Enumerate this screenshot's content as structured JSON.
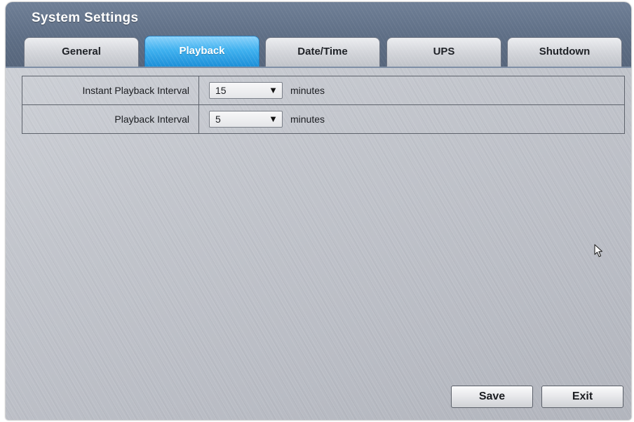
{
  "window": {
    "title": "System Settings"
  },
  "tabs": [
    {
      "label": "General",
      "active": false
    },
    {
      "label": "Playback",
      "active": true
    },
    {
      "label": "Date/Time",
      "active": false
    },
    {
      "label": "UPS",
      "active": false
    },
    {
      "label": "Shutdown",
      "active": false
    }
  ],
  "settings": [
    {
      "label": "Instant Playback Interval",
      "value": "15",
      "unit": "minutes"
    },
    {
      "label": "Playback Interval",
      "value": "5",
      "unit": "minutes"
    }
  ],
  "icons": {
    "dropdown": "triangle-down-icon",
    "pointer": "mouse-pointer-icon"
  },
  "buttons": {
    "save_label": "Save",
    "exit_label": "Exit"
  },
  "colors": {
    "accent": "#2ea4e9",
    "titlebar": "#627289"
  }
}
